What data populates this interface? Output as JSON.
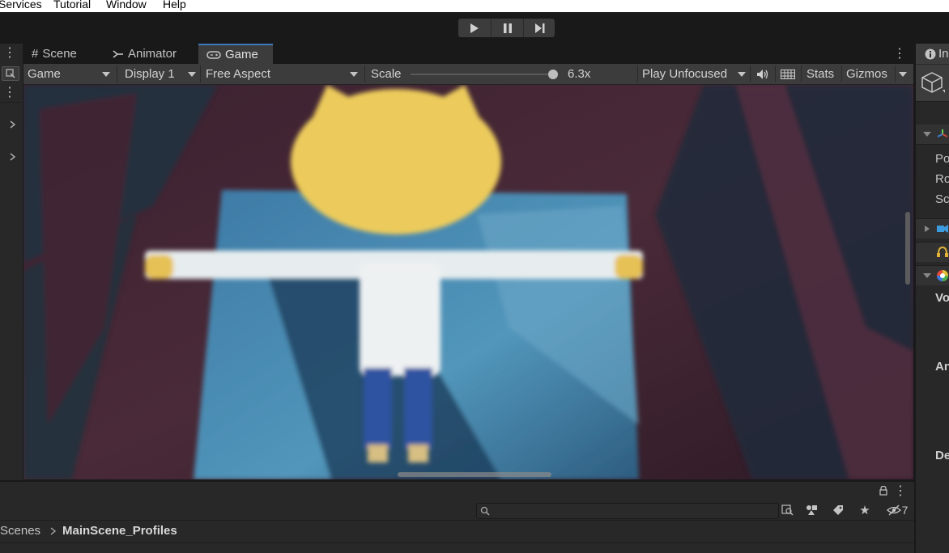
{
  "menu": {
    "items": [
      "Services",
      "Tutorial",
      "Window",
      "Help"
    ]
  },
  "tabs": [
    {
      "label": "Scene",
      "icon": "grid-icon"
    },
    {
      "label": "Animator",
      "icon": "animator-icon"
    },
    {
      "label": "Game",
      "icon": "gamepad-icon",
      "active": true
    }
  ],
  "game_toolbar": {
    "game_dropdown": "Game",
    "display_dropdown": "Display 1",
    "aspect_dropdown": "Free Aspect",
    "scale_label": "Scale",
    "scale_value": "6.3x",
    "scale_fraction": 0.98,
    "play_mode_dropdown": "Play Unfocused",
    "stats_label": "Stats",
    "gizmos_label": "Gizmos"
  },
  "inspector": {
    "tab_label": "In",
    "rows": [
      "Po",
      "Ro",
      "Sc",
      "Vo",
      "An",
      "De"
    ]
  },
  "project": {
    "breadcrumb": [
      "Scenes",
      "MainScene_Profiles"
    ],
    "hidden_count": "7",
    "search_value": ""
  },
  "colors": {
    "accent_tab": "#3a79bb",
    "panel_bg": "#282828",
    "toolbar_bg": "#3c3c3c"
  }
}
